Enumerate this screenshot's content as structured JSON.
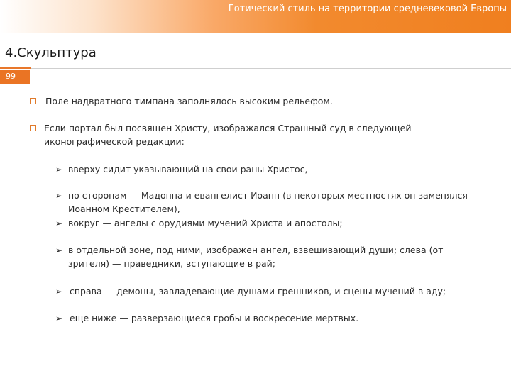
{
  "header": {
    "title": "Готический стиль на территории средневековой Европы"
  },
  "section": {
    "title": "4.Скульптура",
    "page_number": "99"
  },
  "bullets": [
    {
      "text": "Поле надвратного тимпана заполнялось высоким рельефом."
    },
    {
      "line1": "Если портал был посвящен Христу, изображался Страшный суд в следующей",
      "line2": "иконографической редакции:"
    }
  ],
  "subbullets": [
    {
      "line1": "вверху сидит указывающий на свои раны Христос,"
    },
    {
      "line1": "по сторонам — Мадонна и евангелист Иоанн (в некоторых местностях он заменялся",
      "line2": "Иоанном Крестителем),"
    },
    {
      "line1": "вокруг — ангелы с орудиями мучений Христа и апостолы;"
    },
    {
      "line1": "в отдельной зоне, под ними, изображен ангел, взвешивающий души; слева (от",
      "line2": "зрителя) — праведники, вступающие в рай;"
    },
    {
      "line1": "справа — демоны, завладевающие душами грешников, и сцены мучений в аду;"
    },
    {
      "line1": "еще ниже — разверзающиеся гробы и воскресение мертвых."
    }
  ],
  "icons": {
    "bullet": "square-outline-bullet-icon",
    "subbullet": "arrow-bullet-icon"
  },
  "colors": {
    "accent": "#ea7424",
    "header_gradient_end": "#f07f1f"
  }
}
